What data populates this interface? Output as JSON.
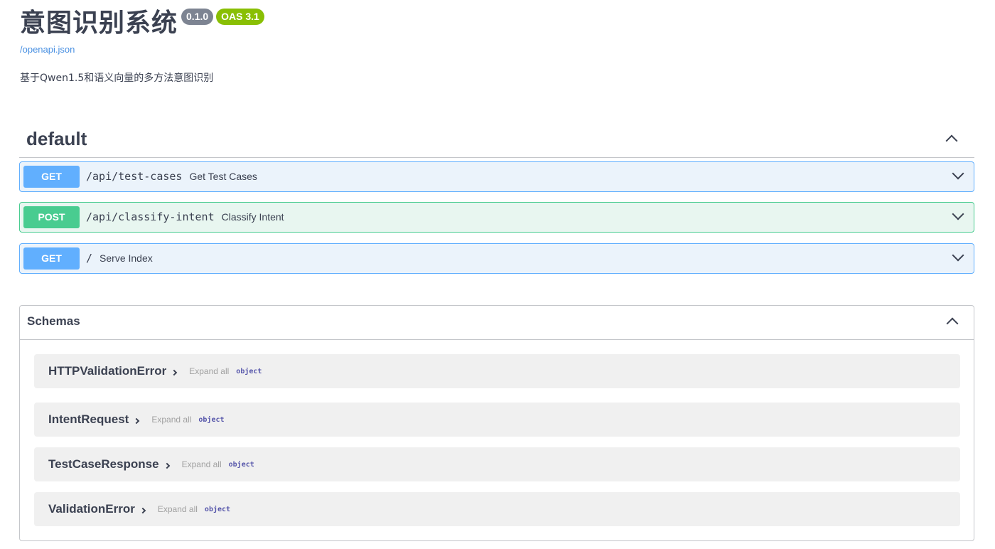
{
  "info": {
    "title": "意图识别系统",
    "version": "0.1.0",
    "oas": "OAS 3.1",
    "openapi_link": "/openapi.json",
    "description": "基于Qwen1.5和语义向量的多方法意图识别"
  },
  "tag": {
    "name": "default"
  },
  "operations": [
    {
      "method": "GET",
      "path": "/api/test-cases",
      "summary": "Get Test Cases"
    },
    {
      "method": "POST",
      "path": "/api/classify-intent",
      "summary": "Classify Intent"
    },
    {
      "method": "GET",
      "path": "/",
      "summary": "Serve Index"
    }
  ],
  "schemas": {
    "title": "Schemas",
    "models": [
      {
        "name": "HTTPValidationError",
        "expand": "Expand all",
        "type": "object"
      },
      {
        "name": "IntentRequest",
        "expand": "Expand all",
        "type": "object"
      },
      {
        "name": "TestCaseResponse",
        "expand": "Expand all",
        "type": "object"
      },
      {
        "name": "ValidationError",
        "expand": "Expand all",
        "type": "object"
      }
    ]
  },
  "colors": {
    "get": "#61affe",
    "post": "#49cc90",
    "oas_badge": "#89bf04",
    "version_badge": "#7d8492"
  }
}
